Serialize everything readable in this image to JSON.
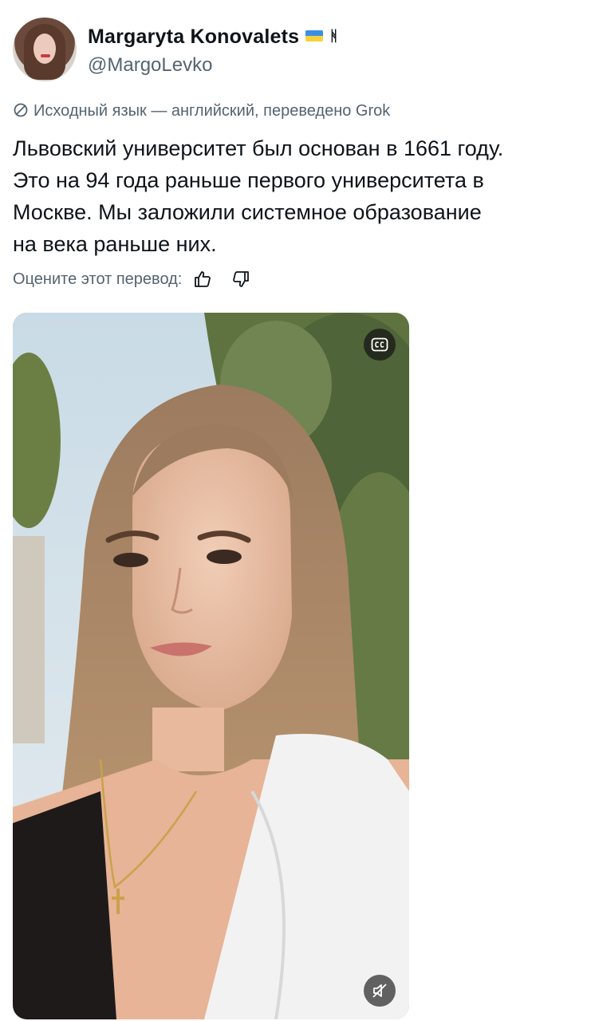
{
  "author": {
    "display_name": "Margaryta Konovalets",
    "handle": "@MargoLevko",
    "badges": [
      "ukraine-flag-icon",
      "trident-icon"
    ],
    "trident_glyph": "ᚱ"
  },
  "translation": {
    "note": "Исходный язык — английский, переведено Grok",
    "icon": "translate-icon"
  },
  "tweet": {
    "lines": [
      "Львовский университет был основан в 1661 году.",
      "Это на 94 года раньше первого университета в",
      "Москве. Мы заложили системное образование",
      "на века раньше них."
    ]
  },
  "rating": {
    "prompt": "Оцените этот перевод:",
    "like_icon": "thumbs-up-icon",
    "dislike_icon": "thumbs-down-icon"
  },
  "media": {
    "type": "video",
    "cc_icon": "closed-captions-icon",
    "mute_icon": "muted-speaker-icon",
    "cc_label": "CC"
  },
  "colors": {
    "text": "#0f1419",
    "secondary": "#536471",
    "flag_blue": "#3b8ee8",
    "flag_yellow": "#f6d23a"
  }
}
